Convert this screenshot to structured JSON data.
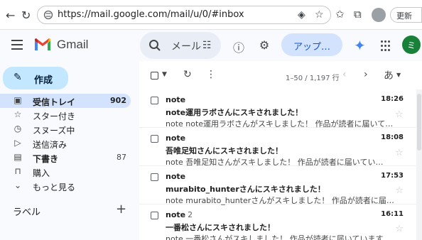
{
  "browser": {
    "url": "https://mail.google.com/mail/u/0/#inbox",
    "update_label": "更新"
  },
  "header": {
    "brand": "Gmail",
    "search_placeholder": "メール",
    "upgrade_label": "アップ…",
    "avatar_initial": "ミ",
    "accent_color": "#0b57d0"
  },
  "sidebar": {
    "compose_label": "作成",
    "items": [
      {
        "label": "受信トレイ",
        "count": "902",
        "icon": "inbox-icon"
      },
      {
        "label": "スター付き",
        "count": "",
        "icon": "star-icon"
      },
      {
        "label": "スヌーズ中",
        "count": "",
        "icon": "clock-icon"
      },
      {
        "label": "送信済み",
        "count": "",
        "icon": "send-icon"
      },
      {
        "label": "下書き",
        "count": "87",
        "icon": "draft-icon"
      },
      {
        "label": "購入",
        "count": "",
        "icon": "bag-icon"
      },
      {
        "label": "もっと見る",
        "count": "",
        "icon": "chevron-down-icon"
      }
    ],
    "labels_title": "ラベル"
  },
  "toolbar": {
    "pager": "1–50 / 1,197 行",
    "lang": "あ"
  },
  "emails": [
    {
      "sender": "note",
      "thread": "",
      "time": "18:26",
      "subject": "note運用ラボさんにスキされました！",
      "snippet": "note note運用ラボさんがスキしました！ 作品が読者に届いて…"
    },
    {
      "sender": "note",
      "thread": "",
      "time": "18:08",
      "subject": "吾唯足知さんにスキされました！",
      "snippet": "note 吾唯足知さんがスキしました！ 作品が読者に届いてい…"
    },
    {
      "sender": "note",
      "thread": "",
      "time": "17:53",
      "subject": "murabito_hunterさんにスキされました！",
      "snippet": "note murabito_hunterさんがスキしました！ 作品が読者に届…"
    },
    {
      "sender": "note",
      "thread": "2",
      "time": "16:11",
      "subject": "一番松さんにスキされました！",
      "snippet": "note 一番松さんがスキしました！ 作品が読者に届いています…"
    }
  ]
}
